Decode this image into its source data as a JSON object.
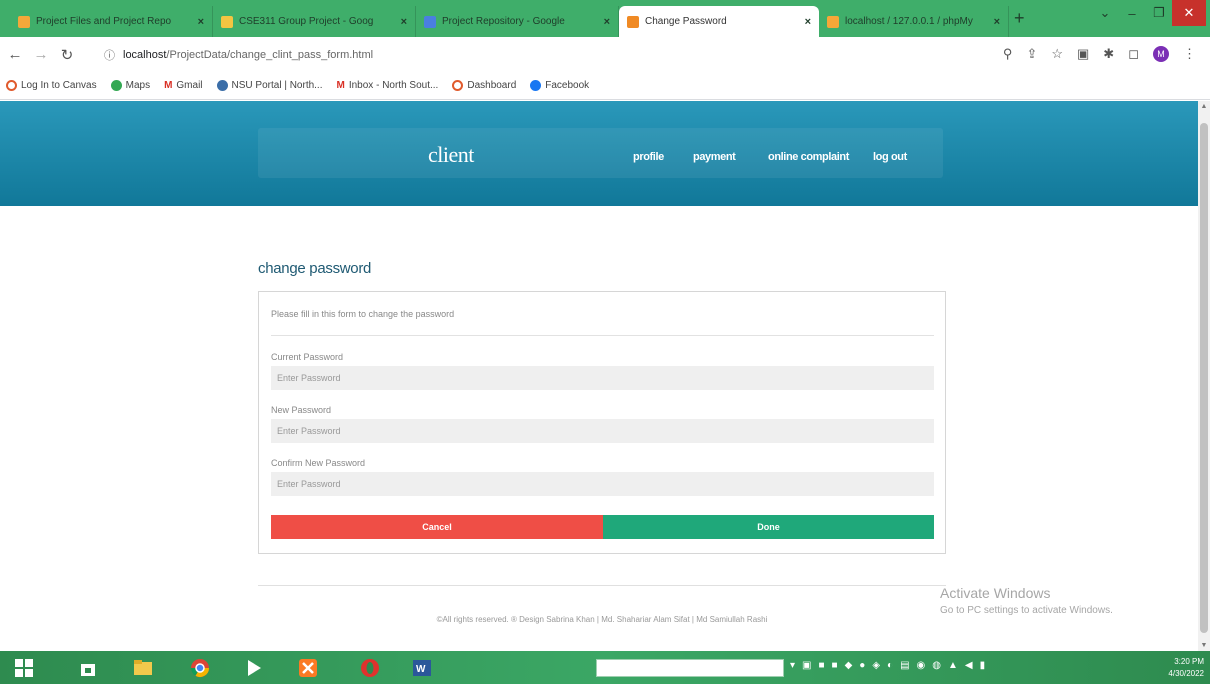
{
  "browser": {
    "tabs": [
      {
        "title": "Project Files and Project Repo",
        "color": "#f4a83a"
      },
      {
        "title": "CSE311 Group Project - Goog",
        "color": "#f4c542"
      },
      {
        "title": "Project Repository - Google",
        "color": "#4a7fe0"
      },
      {
        "title": "Change Password",
        "color": "#f08a24",
        "active": true
      },
      {
        "title": "localhost / 127.0.0.1 / phpMy",
        "color": "#f7a738"
      }
    ],
    "new_tab": "+",
    "url_host": "localhost",
    "url_path": "/ProjectData/change_clint_pass_form.html",
    "profile_initial": "M"
  },
  "bookmarks": [
    {
      "label": "Log In to Canvas",
      "color": "#e05a2c"
    },
    {
      "label": "Maps",
      "color": "#34a853"
    },
    {
      "label": "Gmail",
      "color": "#d93025"
    },
    {
      "label": "NSU Portal | North...",
      "color": "#3b6ea8"
    },
    {
      "label": "Inbox - North Sout...",
      "color": "#d93025"
    },
    {
      "label": "Dashboard",
      "color": "#e05a2c"
    },
    {
      "label": "Facebook",
      "color": "#1877f2"
    }
  ],
  "site": {
    "brand": "client",
    "nav": [
      "profile",
      "payment",
      "online complaint",
      "log out"
    ]
  },
  "form": {
    "title": "change password",
    "hint": "Please fill in this form to change the password",
    "fields": [
      {
        "label": "Current Password",
        "placeholder": "Enter Password"
      },
      {
        "label": "New Password",
        "placeholder": "Enter Password"
      },
      {
        "label": "Confirm New Password",
        "placeholder": "Enter Password"
      }
    ],
    "cancel_label": "Cancel",
    "done_label": "Done"
  },
  "footer": {
    "text": "©All rights reserved. ® Design Sabrina Khan | Md. Shahariar Alam Sifat | Md Samiullah Rashi"
  },
  "watermark": {
    "title": "Activate Windows",
    "subtitle": "Go to PC settings to activate Windows."
  },
  "taskbar": {
    "time": "3:20 PM",
    "date": "4/30/2022"
  }
}
